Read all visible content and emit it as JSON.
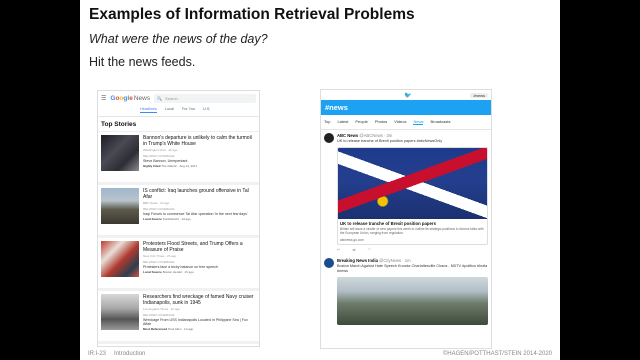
{
  "slide": {
    "title": "Examples of Information Retrieval Problems",
    "subtitle": "What were the news of the day?",
    "line": "Hit the news feeds.",
    "footer_left_1": "IR:I-23",
    "footer_left_2": "Introduction",
    "footer_right": "©HAGEN/POTTHAST/STEIN 2014-2020"
  },
  "google_news": {
    "logo_g": [
      "G",
      "o",
      "o",
      "g",
      "l",
      "e"
    ],
    "logo_news": "News",
    "search_placeholder": "Search",
    "tabs": [
      "Headlines",
      "Local",
      "For You",
      "U.S."
    ],
    "section_title": "Top Stories",
    "stories": [
      {
        "headline": "Bannon's departure is unlikely to calm the turmoil in Trump's White House",
        "source": "Washington Post · 4h ago",
        "related": "RELATED COVERAGE",
        "sub": "Steve Bannon, Unrepentant",
        "tag_label": "Highly Cited",
        "tag_source": "The Atlantic · Aug 14, 2017"
      },
      {
        "headline": "IS conflict: Iraq launches ground offensive in Tal Afar",
        "source": "BBC News · 2h ago",
        "related": "RELATED COVERAGE",
        "sub": "Iraqi Forces to commence Tal Afar operation 'in the next few days'",
        "tag_label": "Local Source",
        "tag_source": "Kurdistan24 · 1d ago"
      },
      {
        "headline": "Protesters Flood Streets, and Trump Offers a Measure of Praise",
        "source": "New York Times · 2h ago",
        "related": "RELATED COVERAGE",
        "sub": "Protesters face a tricky balance on free speech",
        "tag_label": "Local Source",
        "tag_source": "Boston Herald · 1h ago"
      },
      {
        "headline": "Researchers find wreckage of famed Navy cruiser Indianapolis, sunk in 1945",
        "source": "Los Angeles Times · 1h ago",
        "related": "RELATED COVERAGE",
        "sub": "Wreckage From USS Indianapolis Located In Philippine Sea | Fox Affair",
        "tag_label": "Most Referenced",
        "tag_source": "Paul Allen · 1d ago"
      }
    ]
  },
  "twitter": {
    "search_tag": "#news",
    "banner": "#news",
    "tabs": [
      "Top",
      "Latest",
      "People",
      "Photos",
      "Videos",
      "News",
      "Broadcasts"
    ],
    "active_tab": "News",
    "tweets": [
      {
        "name": "ABC News",
        "handle": "@ABCNews · 3m",
        "text": "UK to release tranche of Brexit position papers #abcNewsOnly",
        "card_title": "UK to release tranche of Brexit position papers",
        "card_desc": "Britain will issue a cluster of new papers this week to outline its strategic positions in divorce talks with the European Union, ranging from regulation.",
        "card_link": "abcnews.go.com"
      },
      {
        "name": "Breaking News India",
        "handle": "@CityNews · 1m",
        "text": "Boston March Against Hate Speech Knocks Charlottesville Chaos - NDTV #politics #India #news"
      }
    ],
    "colors": {
      "accent": "#1da1f2"
    }
  }
}
